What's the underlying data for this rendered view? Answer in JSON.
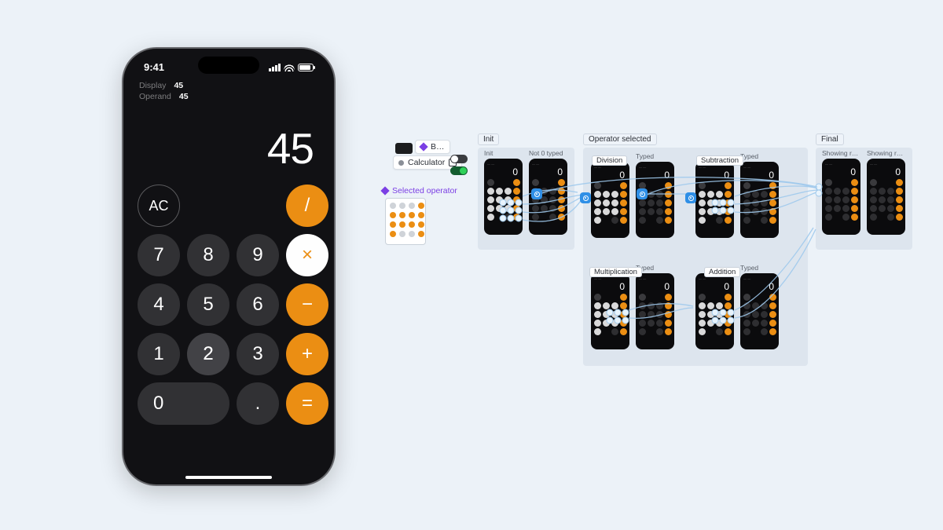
{
  "phone": {
    "status": {
      "time": "9:41"
    },
    "meta": {
      "display_label": "Display",
      "display_value": "45",
      "operand_label": "Operand",
      "operand_value": "45"
    },
    "display": "45",
    "keys": {
      "ac": "AC",
      "divide": "/",
      "seven": "7",
      "eight": "8",
      "nine": "9",
      "times": "×",
      "four": "4",
      "five": "5",
      "six": "6",
      "minus": "−",
      "one": "1",
      "two": "2",
      "three": "3",
      "plus": "+",
      "zero": "0",
      "dot": ".",
      "equals": "="
    }
  },
  "canvas": {
    "calc_tag": "Calculator",
    "b_tag": "B…",
    "selected_operator": "Selected operator",
    "groups": {
      "init": "Init",
      "operator_selected": "Operator selected",
      "final": "Final"
    },
    "captions": {
      "not0": "Not 0 typed",
      "typed": "Typed",
      "showing_r": "Showing r…"
    },
    "sublabels": {
      "division": "Division",
      "subtraction": "Subtraction",
      "multiplication": "Multiplication",
      "addition": "Addition"
    },
    "mini_display": "0"
  }
}
